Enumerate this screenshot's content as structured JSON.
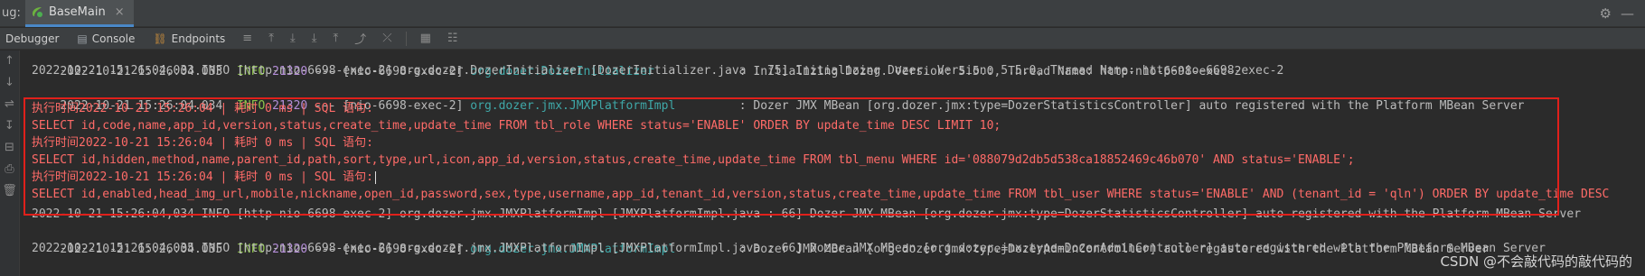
{
  "tabbar": {
    "prefix": "ug:",
    "run_tab_label": "BaseMain",
    "close_glyph": "×",
    "gear_glyph": "⚙",
    "minimize_glyph": "—"
  },
  "toolbar": {
    "debugger_label": "Debugger",
    "console_label": "Console",
    "endpoints_label": "Endpoints",
    "icons": [
      "≡",
      "⤒",
      "⤓",
      "⤓",
      "⤒",
      "⤴",
      "⤫",
      "▦",
      "☷"
    ]
  },
  "gutter_icons": [
    "↑",
    "↓",
    "⇌",
    "↧",
    "⊟",
    "⎙",
    "🗑"
  ],
  "colors": {
    "background": "#2b2b2b",
    "log_text": "#bbbbbb",
    "sql_text": "#ff6b68",
    "info_level": "#8cc34a",
    "pid": "#b58ed9",
    "logger": "#3fa8a8",
    "highlight_border": "#e0201b"
  },
  "log": {
    "line0": {
      "ts": "2022-10-21 15:26:04.033",
      "lvl": "INFO",
      "pid": "21320",
      "sep": "---",
      "thread": "[nio-6698-exec-2]",
      "logger": "org.dozer.DozerInitializer",
      "msg": ": Initializing Dozer. Version: 5.5.0, Thread Name: http-nio-6698-exec-2"
    },
    "line1": "2022-10-21 15:26:04,033 INFO [http-nio-6698-exec-2] org.dozer.DozerInitializer [DozerInitializer.java : 75] Initializing Dozer. Version: 5.5.0, Thread Name: http-nio-6698-exec-2",
    "line2": {
      "ts": "2022-10-21 15:26:04.034",
      "lvl": "INFO",
      "pid": "21320",
      "sep": "---",
      "thread": "[nio-6698-exec-2]",
      "logger": "org.dozer.jmx.JMXPlatformImpl",
      "msg": ": Dozer JMX MBean [org.dozer.jmx:type=DozerStatisticsController] auto registered with the Platform MBean Server"
    },
    "sql1_header": "执行时间2022-10-21 15:26:04 | 耗时 0 ms | SQL 语句:",
    "sql1_body": "SELECT id,code,name,app_id,version,status,create_time,update_time FROM tbl_role WHERE status='ENABLE' ORDER BY update_time DESC LIMIT 10;",
    "sql2_header": "执行时间2022-10-21 15:26:04 | 耗时 0 ms | SQL 语句:",
    "sql2_body": "SELECT id,hidden,method,name,parent_id,path,sort,type,url,icon,app_id,version,status,create_time,update_time FROM tbl_menu WHERE id='088079d2db5d538ca18852469c46b070' AND status='ENABLE';",
    "sql3_header": "执行时间2022-10-21 15:26:04 | 耗时 0 ms | SQL 语句:",
    "sql3_body": "SELECT id,enabled,head_img_url,mobile,nickname,open_id,password,sex,type,username,app_id,tenant_id,version,status,create_time,update_time FROM tbl_user WHERE status='ENABLE' AND (tenant_id = 'qln') ORDER BY update_time DESC",
    "line9": "2022-10-21 15:26:04,034 INFO [http-nio-6698-exec-2] org.dozer.jmx.JMXPlatformImpl [JMXPlatformImpl.java : 66] Dozer JMX MBean [org.dozer.jmx:type=DozerStatisticsController] auto registered with the Platform MBean Server",
    "line10": {
      "ts": "2022-10-21 15:26:04.035",
      "lvl": "INFO",
      "pid": "21320",
      "sep": "---",
      "thread": "[nio-6698-exec-2]",
      "logger": "org.dozer.jmx.JMXPlatformImpl",
      "msg": ": Dozer JMX MBean [org.dozer.jmx:type=DozerAdminController] auto registered with the Platform MBean Server"
    },
    "line11": "2022-10-21 15:26:04,035 INFO [http-nio-6698-exec-2] org.dozer.jmx.JMXPlatformImpl [JMXPlatformImpl.java : 66] Dozer JMX MBean [org.dozer.jmx:type=DozerAdminController] auto registered with the Platform MBean Server"
  },
  "watermark": "CSDN @不会敲代码的敲代码的"
}
